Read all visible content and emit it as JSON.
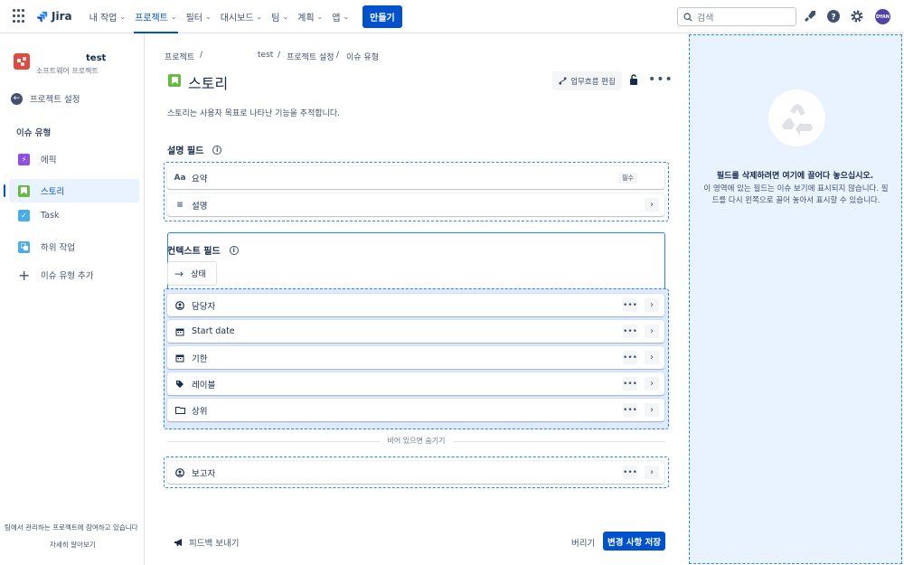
{
  "topbar": {
    "logo": "Jira",
    "nav": [
      "내 작업",
      "프로젝트",
      "필터",
      "대시보드",
      "팀",
      "계획",
      "앱"
    ],
    "create": "만들기",
    "search_placeholder": "검색",
    "avatar_initials": "DYAN"
  },
  "sidebar": {
    "project_name": "test",
    "project_type": "소프트웨어 프로젝트",
    "back_label": "프로젝트 설정",
    "section_heading": "이슈 유형",
    "items": [
      "에픽",
      "스토리",
      "Task",
      "하위 작업",
      "이슈 유형 추가"
    ],
    "footer_text": "팀에서 관리하는 프로젝트에 참여하고 있습니다",
    "footer_link": "자세히 알아보기"
  },
  "breadcrumb": [
    "프로젝트",
    "test",
    "프로젝트 설정",
    "이슈 유형"
  ],
  "header": {
    "title": "스토리",
    "workflow_button": "업무흐름 편집",
    "description": "스토리는 사용자 목표로 나타난 기능을 추적합니다."
  },
  "description_fields": {
    "heading": "설명 필드",
    "fields": [
      {
        "icon": "Aa",
        "label": "요약",
        "badge": "필수"
      },
      {
        "icon": "≡",
        "label": "설명"
      }
    ]
  },
  "context_fields": {
    "heading": "컨텍스트 필드",
    "dragging_chip": "상태",
    "fields": [
      "담당자",
      "Start date",
      "기한",
      "레이블",
      "상위"
    ],
    "hidden_divider": "비어 있으면 숨기기",
    "hidden_fields": [
      "보고자"
    ]
  },
  "footer": {
    "feedback": "피드백 보내기",
    "discard": "버리기",
    "save": "변경 사항 저장"
  },
  "trash_panel": {
    "title": "필드를 삭제하려면 여기에 끌어다 놓으십시오.",
    "description": "이 영역에 있는 필드는 이슈 보기에 표시되지 않습니다. 필드를 다시 왼쪽으로 끌어 놓아서 표시할 수 있습니다."
  },
  "colors": {
    "accent": "#0052cc",
    "drop_zone": "#2684ff",
    "story": "#65ba43",
    "epic": "#904ee2",
    "task": "#4bade8"
  }
}
